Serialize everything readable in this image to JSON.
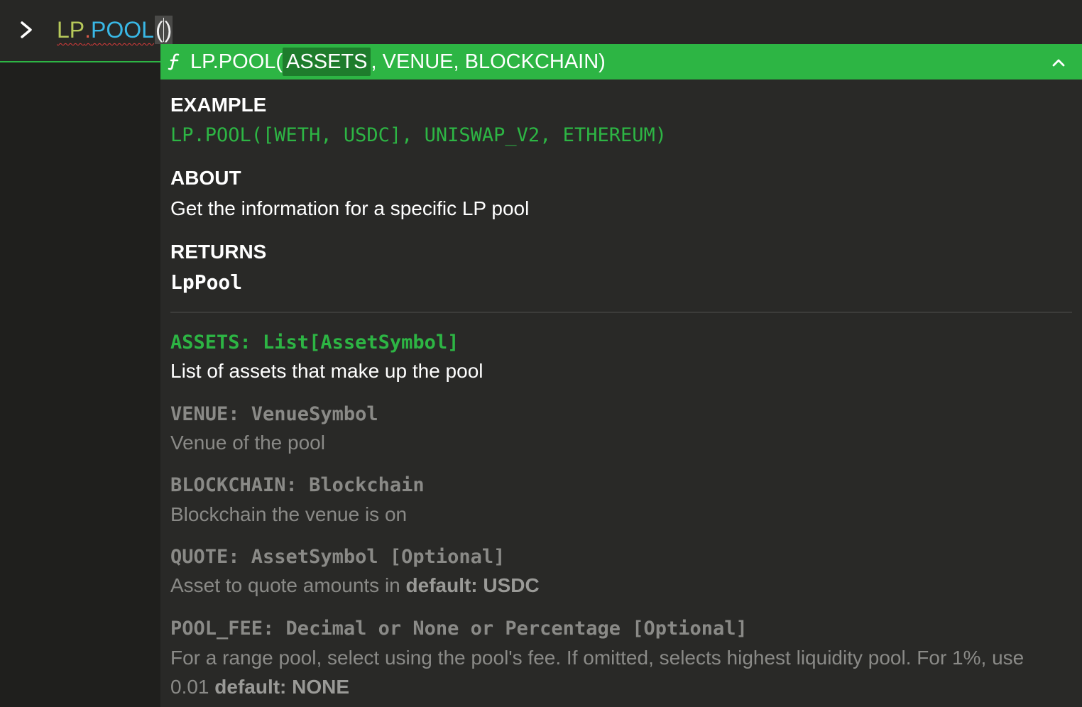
{
  "input": {
    "formula_namespace": "LP",
    "formula_dot": ".",
    "formula_name": "POOL",
    "formula_open": "(",
    "formula_close": ")"
  },
  "icons": {
    "prompt": "chevron-right-icon",
    "function": "function-icon",
    "collapse": "chevron-up-icon"
  },
  "signature": {
    "prefix": "LP.POOL(",
    "active_param": "ASSETS",
    "rest": ", VENUE, BLOCKCHAIN)"
  },
  "example": {
    "heading": "EXAMPLE",
    "code": "LP.POOL([WETH, USDC], UNISWAP_V2, ETHEREUM)"
  },
  "about": {
    "heading": "ABOUT",
    "text": "Get the information for a specific LP pool"
  },
  "returns": {
    "heading": "RETURNS",
    "value": "LpPool"
  },
  "params": [
    {
      "signature": "ASSETS: List[AssetSymbol]",
      "description": "List of assets that make up the pool"
    },
    {
      "signature": "VENUE: VenueSymbol",
      "description": "Venue of the pool"
    },
    {
      "signature": "BLOCKCHAIN: Blockchain",
      "description": "Blockchain the venue is on"
    },
    {
      "signature": "QUOTE: AssetSymbol [Optional]",
      "description": "Asset to quote amounts in ",
      "default": "default: USDC"
    },
    {
      "signature": "POOL_FEE: Decimal or None or Percentage [Optional]",
      "description": "For a range pool, select using the pool's fee. If omitted, selects highest liquidity pool. For 1%, use 0.01 ",
      "default": "default: NONE"
    }
  ],
  "colors": {
    "accent_green": "#2db544",
    "active_param_bg": "#1e7c2c",
    "background": "#1f1f1d",
    "popup_bg": "#292927",
    "dim_text": "#8a8a87",
    "namespace": "#b7c95a",
    "function_name": "#39b8e6",
    "error_underline": "#d83b3b"
  }
}
